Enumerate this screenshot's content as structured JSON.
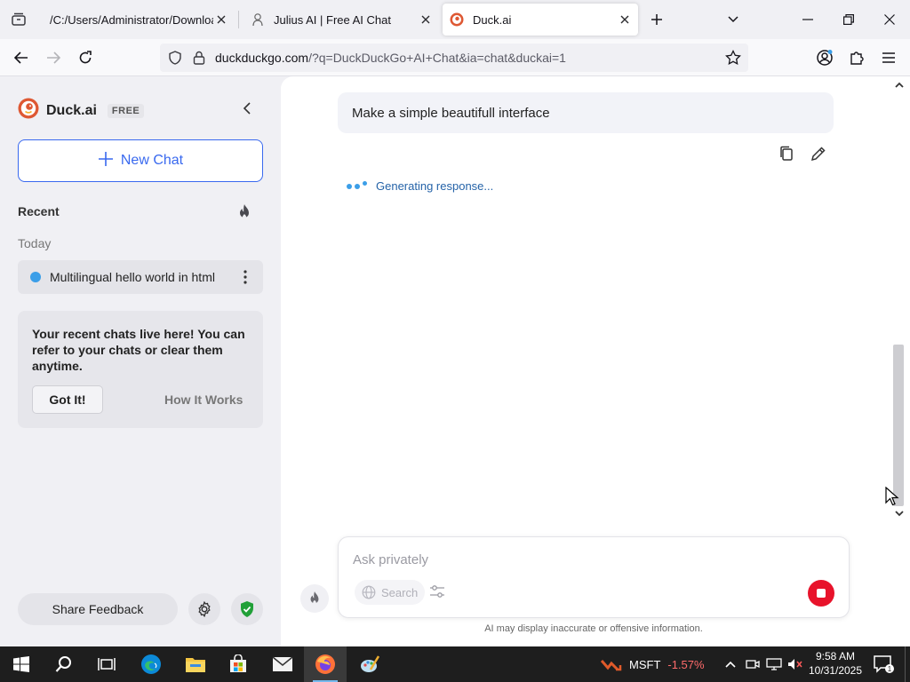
{
  "browser": {
    "tabs": [
      {
        "label": "/C:/Users/Administrator/Downloads",
        "active": false
      },
      {
        "label": "Julius AI | Free AI Chat",
        "active": false
      },
      {
        "label": "Duck.ai",
        "active": true
      }
    ],
    "url": {
      "host": "duckduckgo.com",
      "path": "/?q=DuckDuckGo+AI+Chat&ia=chat&duckai=1"
    }
  },
  "sidebar": {
    "brand_name": "Duck.ai",
    "brand_badge": "FREE",
    "new_chat_label": "New Chat",
    "recent_heading": "Recent",
    "today_label": "Today",
    "chat_items": [
      {
        "label": "Multilingual hello world in html"
      }
    ],
    "tip": {
      "text": "Your recent chats live here! You can refer to your chats or clear them anytime.",
      "got_it": "Got It!",
      "how_it_works": "How It Works"
    },
    "share_feedback": "Share Feedback"
  },
  "chat": {
    "user_message": "Make a simple beautifull interface",
    "status": "Generating response...",
    "input_placeholder": "Ask privately",
    "search_label": "Search",
    "disclaimer": "AI may display inaccurate or offensive information."
  },
  "taskbar": {
    "stock_ticker": "MSFT",
    "stock_change": "-1.57%",
    "time": "9:58 AM",
    "date": "10/31/2025",
    "notification_count": "1"
  },
  "colors": {
    "accent": "#3969ef",
    "dot": "#3b9ee8",
    "stop": "#e8132b",
    "shield": "#21a038",
    "duck_orange": "#de5833"
  }
}
